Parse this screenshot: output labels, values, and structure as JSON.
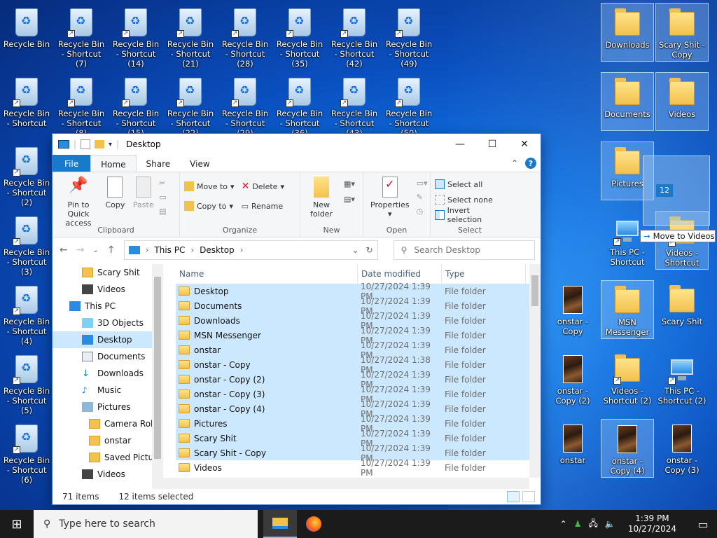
{
  "desktop": {
    "icons": [
      {
        "label": "Recycle Bin",
        "type": "bin"
      },
      {
        "label": "Recycle Bin - Shortcut (7)",
        "type": "bin"
      },
      {
        "label": "Recycle Bin - Shortcut (14)",
        "type": "bin"
      },
      {
        "label": "Recycle Bin - Shortcut (21)",
        "type": "bin"
      },
      {
        "label": "Recycle Bin - Shortcut (28)",
        "type": "bin"
      },
      {
        "label": "Recycle Bin - Shortcut (35)",
        "type": "bin"
      },
      {
        "label": "Recycle Bin - Shortcut (42)",
        "type": "bin"
      },
      {
        "label": "Recycle Bin - Shortcut (49)",
        "type": "bin"
      },
      {
        "label": "Recycle Bin - Shortcut",
        "type": "bin"
      },
      {
        "label": "Recycle Bin - Shortcut (8)",
        "type": "bin"
      },
      {
        "label": "Recycle Bin - Shortcut (15)",
        "type": "bin"
      },
      {
        "label": "Recycle Bin - Shortcut (22)",
        "type": "bin"
      },
      {
        "label": "Recycle Bin - Shortcut (29)",
        "type": "bin"
      },
      {
        "label": "Recycle Bin - Shortcut (36)",
        "type": "bin"
      },
      {
        "label": "Recycle Bin - Shortcut (43)",
        "type": "bin"
      },
      {
        "label": "Recycle Bin - Shortcut (50)",
        "type": "bin"
      },
      {
        "label": "Recycle Bin - Shortcut (2)",
        "type": "bin"
      },
      {
        "label": "Recycle Bin - Shortcut (3)",
        "type": "bin"
      },
      {
        "label": "Recycle Bin - Shortcut (4)",
        "type": "bin"
      },
      {
        "label": "Recycle Bin - Shortcut (5)",
        "type": "bin"
      },
      {
        "label": "Recycle Bin - Shortcut (6)",
        "type": "bin"
      },
      {
        "label": "Downloads",
        "type": "folder"
      },
      {
        "label": "Scary Shit - Copy",
        "type": "folder"
      },
      {
        "label": "Documents",
        "type": "folder"
      },
      {
        "label": "Videos",
        "type": "folder"
      },
      {
        "label": "Pictures",
        "type": "folder"
      },
      {
        "label": "This PC - Shortcut",
        "type": "pc"
      },
      {
        "label": "Videos - Shortcut",
        "type": "folder"
      },
      {
        "label": "onstar - Copy",
        "type": "image"
      },
      {
        "label": "MSN Messenger",
        "type": "folder"
      },
      {
        "label": "Scary Shit",
        "type": "folder"
      },
      {
        "label": "onstar - Copy (2)",
        "type": "image"
      },
      {
        "label": "Videos - Shortcut (2)",
        "type": "folder"
      },
      {
        "label": "This PC - Shortcut (2)",
        "type": "pc"
      },
      {
        "label": "onstar",
        "type": "image"
      },
      {
        "label": "onstar - Copy (4)",
        "type": "image"
      },
      {
        "label": "onstar - Copy (3)",
        "type": "image"
      }
    ],
    "drag_count": "12",
    "drag_tooltip": "Move to Videos"
  },
  "window": {
    "title": "Desktop",
    "tabs": [
      "File",
      "Home",
      "Share",
      "View"
    ],
    "ribbon": {
      "clipboard": {
        "pin": "Pin to Quick access",
        "copy": "Copy",
        "paste": "Paste",
        "name": "Clipboard"
      },
      "organize": {
        "move_to": "Move to",
        "copy_to": "Copy to",
        "delete": "Delete",
        "rename": "Rename",
        "name": "Organize"
      },
      "new": {
        "new_folder": "New folder",
        "name": "New"
      },
      "open": {
        "properties": "Properties",
        "name": "Open"
      },
      "select": {
        "all": "Select all",
        "none": "Select none",
        "invert": "Invert selection",
        "name": "Select"
      }
    },
    "address": {
      "parts": [
        "This PC",
        "Desktop"
      ],
      "search_placeholder": "Search Desktop"
    },
    "nav": [
      {
        "label": "Scary Shit",
        "indent": 1
      },
      {
        "label": "Videos",
        "indent": 1
      },
      {
        "label": "This PC",
        "indent": 0
      },
      {
        "label": "3D Objects",
        "indent": 1
      },
      {
        "label": "Desktop",
        "indent": 1,
        "selected": true
      },
      {
        "label": "Documents",
        "indent": 1
      },
      {
        "label": "Downloads",
        "indent": 1
      },
      {
        "label": "Music",
        "indent": 1
      },
      {
        "label": "Pictures",
        "indent": 1
      },
      {
        "label": "Camera Roll",
        "indent": 2
      },
      {
        "label": "onstar",
        "indent": 2
      },
      {
        "label": "Saved Pictures",
        "indent": 2
      },
      {
        "label": "Videos",
        "indent": 1
      }
    ],
    "columns": {
      "name": "Name",
      "date": "Date modified",
      "type": "Type"
    },
    "files": [
      {
        "name": "Desktop",
        "date": "10/27/2024 1:39 PM",
        "type": "File folder",
        "selected": true
      },
      {
        "name": "Documents",
        "date": "10/27/2024 1:39 PM",
        "type": "File folder",
        "selected": true
      },
      {
        "name": "Downloads",
        "date": "10/27/2024 1:39 PM",
        "type": "File folder",
        "selected": true
      },
      {
        "name": "MSN Messenger",
        "date": "10/27/2024 1:39 PM",
        "type": "File folder",
        "selected": true
      },
      {
        "name": "onstar",
        "date": "10/27/2024 1:39 PM",
        "type": "File folder",
        "selected": true
      },
      {
        "name": "onstar - Copy",
        "date": "10/27/2024 1:38 PM",
        "type": "File folder",
        "selected": true
      },
      {
        "name": "onstar - Copy (2)",
        "date": "10/27/2024 1:39 PM",
        "type": "File folder",
        "selected": true
      },
      {
        "name": "onstar - Copy (3)",
        "date": "10/27/2024 1:39 PM",
        "type": "File folder",
        "selected": true
      },
      {
        "name": "onstar - Copy (4)",
        "date": "10/27/2024 1:39 PM",
        "type": "File folder",
        "selected": true
      },
      {
        "name": "Pictures",
        "date": "10/27/2024 1:39 PM",
        "type": "File folder",
        "selected": true
      },
      {
        "name": "Scary Shit",
        "date": "10/27/2024 1:39 PM",
        "type": "File folder",
        "selected": true
      },
      {
        "name": "Scary Shit - Copy",
        "date": "10/27/2024 1:39 PM",
        "type": "File folder",
        "selected": true
      },
      {
        "name": "Videos",
        "date": "10/27/2024 1:39 PM",
        "type": "File folder",
        "selected": false
      }
    ],
    "status": {
      "items": "71 items",
      "selected": "12 items selected"
    }
  },
  "taskbar": {
    "search_placeholder": "Type here to search",
    "time": "1:39 PM",
    "date": "10/27/2024"
  },
  "colors": {
    "accent": "#1979ca",
    "selection": "#cce8ff"
  }
}
